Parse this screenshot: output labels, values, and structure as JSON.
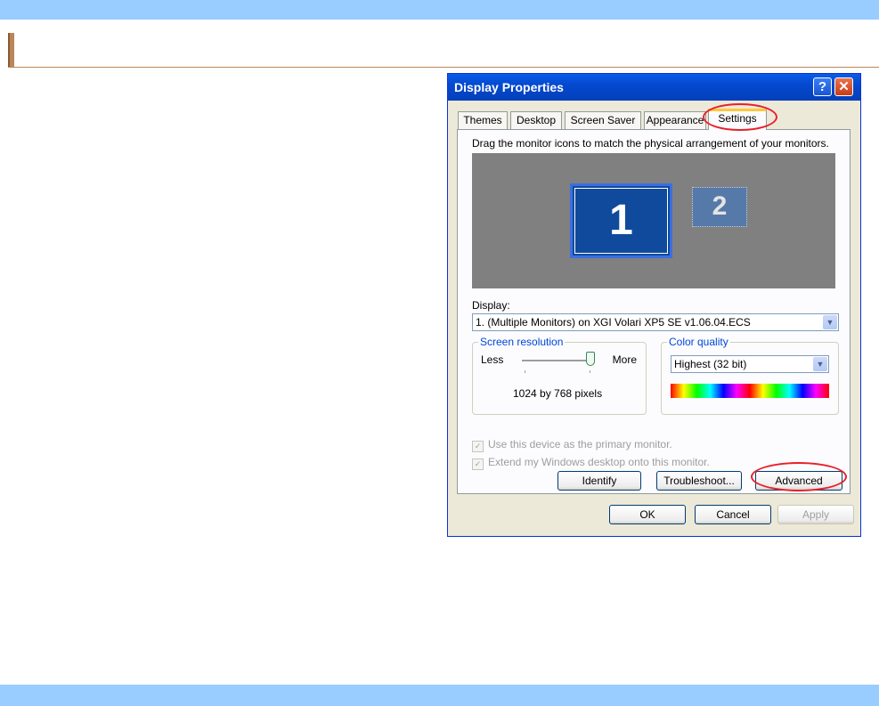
{
  "dialog": {
    "title": "Display Properties",
    "help_glyph": "?",
    "close_glyph": "✕"
  },
  "tabs": [
    {
      "label": "Themes"
    },
    {
      "label": "Desktop"
    },
    {
      "label": "Screen Saver"
    },
    {
      "label": "Appearance"
    },
    {
      "label": "Settings"
    }
  ],
  "settings": {
    "instruction": "Drag the monitor icons to match the physical arrangement of your monitors.",
    "monitors": [
      {
        "label": "1",
        "state": "selected"
      },
      {
        "label": "2",
        "state": "inactive"
      }
    ],
    "display_label": "Display:",
    "display_value": "1. (Multiple Monitors) on XGI Volari XP5 SE  v1.06.04.ECS",
    "resolution": {
      "legend": "Screen resolution",
      "less": "Less",
      "more": "More",
      "value": "1024 by 768 pixels",
      "slider_level": 1.0
    },
    "color_quality": {
      "legend": "Color quality",
      "value": "Highest (32 bit)"
    },
    "checkbox_primary": "Use this device as the primary monitor.",
    "checkbox_extend": "Extend my Windows desktop onto this monitor.",
    "checkbox_checked_glyph": "✓",
    "dropdown_glyph": "▼"
  },
  "buttons": {
    "identify": "Identify",
    "troubleshoot": "Troubleshoot...",
    "advanced": "Advanced",
    "ok": "OK",
    "cancel": "Cancel",
    "apply": "Apply"
  },
  "colors": {
    "page_band": "#99ccff",
    "titlebar": "#0449d0",
    "annotation": "#e8202a",
    "accent_rule": "#b8875a"
  }
}
